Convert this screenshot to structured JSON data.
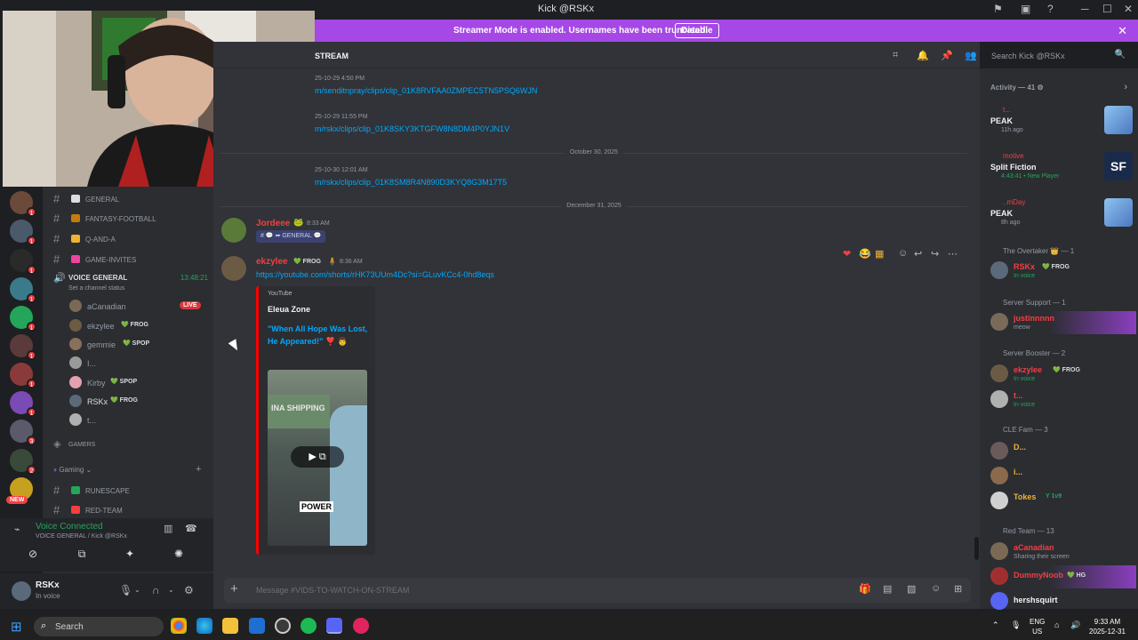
{
  "window": {
    "title": "Kick @RSKx",
    "controls": [
      "─",
      "☐",
      "✕"
    ]
  },
  "banner": {
    "message": "Streamer Mode is enabled. Usernames have been truncated.",
    "button": "Disable",
    "close": "✕"
  },
  "channels": {
    "text_channels": [
      {
        "label": "GENERAL",
        "icon_color": "#dbdee1"
      },
      {
        "label": "FANTASY-FOOTBALL",
        "icon_color": "#c27c0e"
      },
      {
        "label": "Q-AND-A",
        "icon_color": "#f0b232"
      },
      {
        "label": "GAME-INVITES",
        "icon_color": "#eb459f"
      }
    ],
    "voice": {
      "title": "VOICE GENERAL",
      "timer": "13:48:21",
      "status": "Set a channel status",
      "live": "LIVE",
      "users": [
        {
          "name": "aCanadian",
          "tag": "",
          "color": "#7a6a55"
        },
        {
          "name": "ekzylee",
          "tag": "FROG",
          "color": "#6b5b45"
        },
        {
          "name": "gemmie",
          "tag": "SPOP",
          "color": "#8a6f5a"
        },
        {
          "name": "I...",
          "tag": "",
          "color": "#9a9a9a"
        },
        {
          "name": "Kirby",
          "tag": "SPOP",
          "color": "#e5a0b0"
        },
        {
          "name": "RSKx",
          "tag": "FROG",
          "color": "#5a6a7a"
        },
        {
          "name": "t...",
          "tag": "",
          "color": "#b0b0b0"
        }
      ]
    },
    "category_gamers": "GAMERS",
    "category_gaming": "Gaming",
    "gaming_channels": [
      {
        "label": "RUNESCAPE",
        "icon_color": "#23a55a"
      },
      {
        "label": "RED-TEAM",
        "icon_color": "#f23f43"
      }
    ]
  },
  "servers": [
    {
      "badge": "1",
      "color": "#6b4a3a"
    },
    {
      "badge": "1",
      "color": "#4a5a6a"
    },
    {
      "badge": "1",
      "color": "#2a2a2a"
    },
    {
      "badge": "1",
      "color": "#3a7a8a"
    },
    {
      "badge": "1",
      "color": "#23a55a"
    },
    {
      "badge": "1",
      "color": "#5a3a3a"
    },
    {
      "badge": "1",
      "color": "#8a3a3a"
    },
    {
      "badge": "1",
      "color": "#7a4ab5"
    },
    {
      "badge": "3",
      "color": "#5a5a6a"
    },
    {
      "badge": "2",
      "color": "#3a4a3a"
    },
    {
      "badge": "",
      "color": "#c8a020"
    }
  ],
  "new_badge": "NEW",
  "voice_panel": {
    "status": "Voice Connected",
    "sub": "VOICE GENERAL / Kick @RSKx"
  },
  "user": {
    "name": "RSKx",
    "status": "In voice"
  },
  "chat": {
    "channel_name": "STREAM",
    "search_placeholder": "Search Kick @RSKx",
    "messages_top": [
      {
        "ts": "25-10-29 4:50 PM",
        "link": "m/senditnpray/clips/clip_01K8RVFAA0ZMPEC5TN5PSQ6WJN"
      },
      {
        "ts": "25-10-29 11:55 PM",
        "link": "m/rskx/clips/clip_01K8SKY3KTGFW8N8DM4P0YJN1V"
      },
      {
        "ts": "25-10-30 12:01 AM",
        "link": "m/rskx/clips/clip_01K8SM8R4N890D3KYQ8G3M17T5"
      }
    ],
    "divider1": "October 30, 2025",
    "divider2": "December 31, 2025",
    "msg1": {
      "author": "Jordeee",
      "time": "8:33 AM",
      "mention": "GENERAL"
    },
    "msg2": {
      "author": "ekzylee",
      "tag": "FROG",
      "time": "8:36 AM",
      "link": "https://youtube.com/shorts/rHK73UUm4Dc?si=GLuvKCc4-0hd8eqs",
      "embed_provider": "YouTube",
      "embed_author": "Eleua Zone",
      "embed_title": "\"When All Hope Was Lost, He Appeared!\" ❣️ 👨",
      "thumb_sign": "INA SHIPPING",
      "thumb_caption": "POWER"
    },
    "composer_placeholder": "Message #VIDS-TO-WATCH-ON-STREAM"
  },
  "members": {
    "activity_header": "Activity — 41",
    "activities": [
      {
        "user": "t...",
        "name": "PEAK",
        "meta": "11h ago",
        "pic": "#5b8fd0"
      },
      {
        "user": "motive",
        "name": "Split Fiction",
        "meta": "4:43:41 • New Player",
        "pic": "#1a2a4a"
      },
      {
        "user": "..mDay",
        "name": "PEAK",
        "meta": "8h ago",
        "pic": "#5b8fd0"
      }
    ],
    "sections": [
      {
        "title": "The Overtaker 👑 — 1"
      },
      {
        "title": "Server Support — 1"
      },
      {
        "title": "Server Booster — 2"
      },
      {
        "title": "CLE Fam — 3"
      },
      {
        "title": "Red Team — 13"
      }
    ],
    "list": [
      {
        "name": "RSKx",
        "tag": "FROG",
        "status": "In voice",
        "color": "#f23f43",
        "av": "#5a6a7a"
      },
      {
        "name": "justinnnnn",
        "tag": "",
        "status": "meow",
        "color": "#f23f43",
        "av": "#7a6a5a"
      },
      {
        "name": "ekzylee",
        "tag": "FROG",
        "status": "In voice",
        "color": "#f23f43",
        "av": "#6b5b45"
      },
      {
        "name": "t...",
        "tag": "",
        "status": "In voice",
        "color": "#f23f43",
        "av": "#b0b0b0"
      },
      {
        "name": "D...",
        "tag": "",
        "status": "",
        "color": "#f0b232",
        "av": "#6a5a5a"
      },
      {
        "name": "i...",
        "tag": "",
        "status": "",
        "color": "#f0b232",
        "av": "#8a6a4a"
      },
      {
        "name": "Tokes",
        "tag": "1v9",
        "status": "",
        "color": "#f0b232",
        "av": "#d0d0d0"
      },
      {
        "name": "aCanadian",
        "tag": "",
        "status": "Sharing their screen",
        "color": "#f23f43",
        "av": "#7a6a55"
      },
      {
        "name": "DummyNoob",
        "tag": "HG",
        "status": "",
        "color": "#f23f43",
        "av": "#a03030"
      },
      {
        "name": "hershsquirt",
        "tag": "",
        "status": "",
        "color": "#f2f3f5",
        "av": "#5865f2"
      }
    ]
  },
  "taskbar": {
    "search_placeholder": "Search",
    "lang_line1": "ENG",
    "lang_line2": "US",
    "time": "9:33 AM",
    "date": "2025-12-31"
  }
}
